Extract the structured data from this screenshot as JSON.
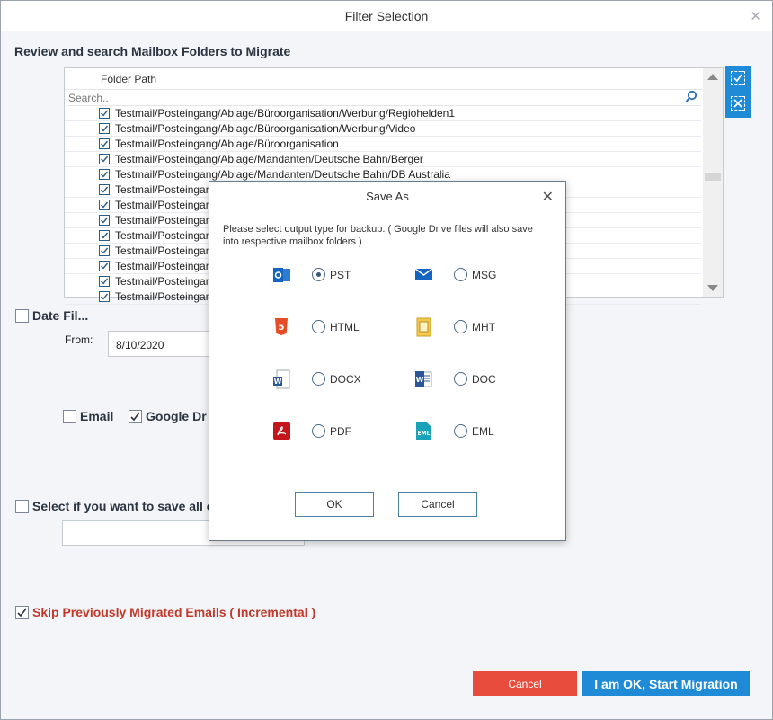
{
  "window": {
    "title": "Filter Selection",
    "close_glyph": "✕"
  },
  "section_heading": "Review and search Mailbox Folders to Migrate",
  "folder_panel": {
    "column_header": "Folder Path",
    "search_placeholder": "Search..",
    "rows": [
      "Testmail/Posteingang/Ablage/Büroorganisation/Werbung/Regiohelden1",
      "Testmail/Posteingang/Ablage/Büroorganisation/Werbung/Video",
      "Testmail/Posteingang/Ablage/Büroorganisation",
      "Testmail/Posteingang/Ablage/Mandanten/Deutsche Bahn/Berger",
      "Testmail/Posteingang/Ablage/Mandanten/Deutsche Bahn/DB Australia",
      "Testmail/Posteingang/A",
      "Testmail/Posteingang/A",
      "Testmail/Posteingang/A",
      "Testmail/Posteingang/A",
      "Testmail/Posteingang/A",
      "Testmail/Posteingang/A",
      "Testmail/Posteingang/A",
      "Testmail/Posteingang/A"
    ]
  },
  "date_filter": {
    "label": "Date Fil...",
    "from_label": "From:",
    "from_value": "8/10/2020"
  },
  "email_label": "Email",
  "google_drive_label": "Google Dr",
  "save_all_label": "Select if you want to save all c",
  "skip_label": "Skip Previously Migrated Emails ( Incremental )",
  "buttons": {
    "cancel": "Cancel",
    "start": "I am OK, Start Migration"
  },
  "dialog": {
    "title": "Save As",
    "close_glyph": "✕",
    "message": "Please select output type for backup. ( Google Drive files will also save into respective mailbox folders )",
    "options": [
      {
        "label": "PST",
        "icon": "outlook-pst-icon",
        "selected": true
      },
      {
        "label": "MSG",
        "icon": "envelope-msg-icon",
        "selected": false
      },
      {
        "label": "HTML",
        "icon": "html5-icon",
        "selected": false
      },
      {
        "label": "MHT",
        "icon": "mht-file-icon",
        "selected": false
      },
      {
        "label": "DOCX",
        "icon": "word-docx-icon",
        "selected": false
      },
      {
        "label": "DOC",
        "icon": "word-doc-icon",
        "selected": false
      },
      {
        "label": "PDF",
        "icon": "pdf-icon",
        "selected": false
      },
      {
        "label": "EML",
        "icon": "eml-file-icon",
        "selected": false
      }
    ],
    "ok_label": "OK",
    "cancel_label": "Cancel"
  },
  "colors": {
    "accent": "#1f8bd6",
    "danger": "#e74c3c",
    "skip_text": "#c0392b"
  }
}
